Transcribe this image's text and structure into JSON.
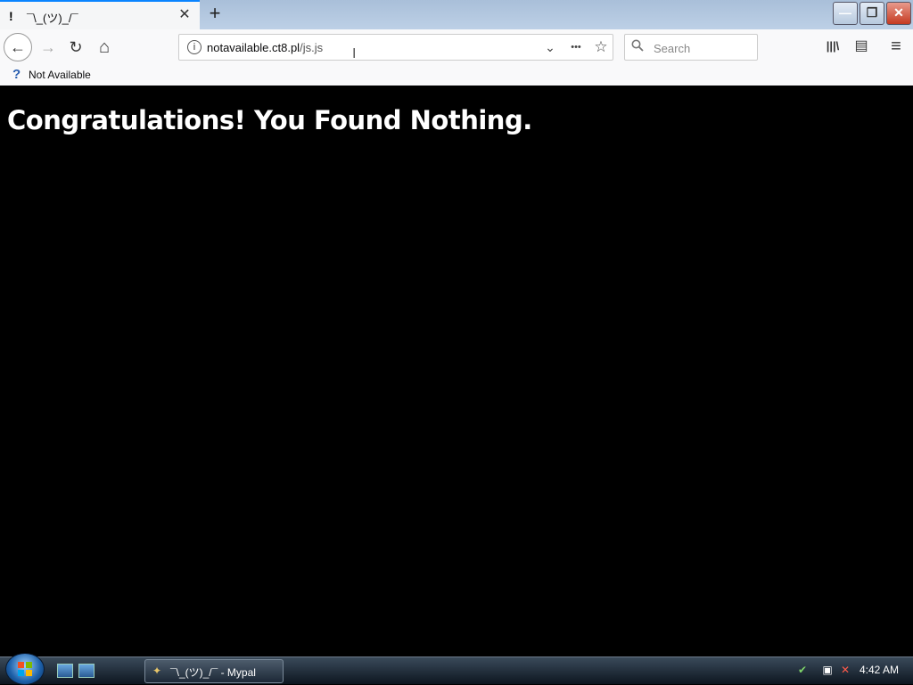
{
  "window": {
    "tab_title": "¯\\_(ツ)_/¯",
    "tab_favicon": "!",
    "minimize": "—",
    "maximize": "❐",
    "close": "✕",
    "accent_color": "#0a84ff"
  },
  "toolbar": {
    "back_icon": "←",
    "forward_icon": "→",
    "reload_icon": "↻",
    "home_icon": "⌂",
    "url_info_icon": "i",
    "url_host": "notavailable.ct8.pl",
    "url_path": "/js.js",
    "dropdown_icon": "⌄",
    "more_icon": "•••",
    "bookmark_star_icon": "☆",
    "search_placeholder": "Search",
    "library_icon": "|||\\",
    "sidebar_icon": "▤",
    "menu_icon": "≡"
  },
  "bookmarks": {
    "items": [
      {
        "label": "Not Available",
        "icon": "?"
      }
    ]
  },
  "page": {
    "heading": "Congratulations! You Found Nothing.",
    "background": "#000000",
    "text_color": "#ffffff"
  },
  "taskbar": {
    "task_label": "¯\\_(ツ)_/¯ - Mypal",
    "clock": "4:42 AM"
  }
}
